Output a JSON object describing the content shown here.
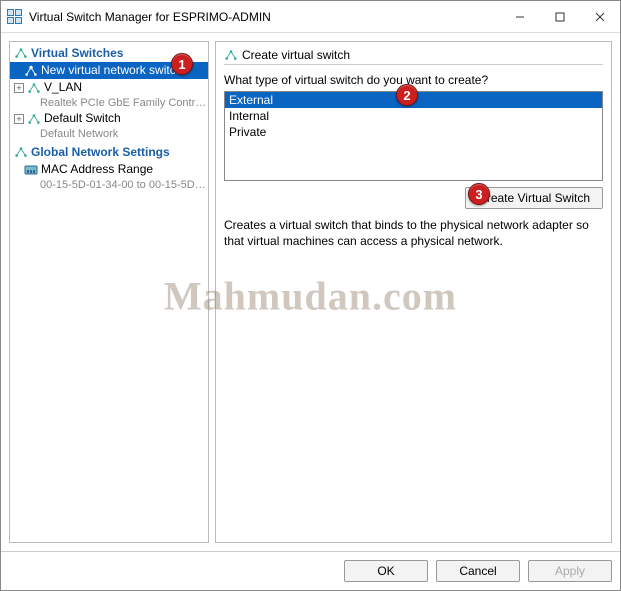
{
  "window": {
    "title": "Virtual Switch Manager for ESPRIMO-ADMIN"
  },
  "tree": {
    "virtual_switches_header": "Virtual Switches",
    "new_switch": "New virtual network switch",
    "vlan": {
      "name": "V_LAN",
      "desc": "Realtek PCIe GbE Family Controller"
    },
    "default_switch": {
      "name": "Default Switch",
      "desc": "Default Network"
    },
    "global_header": "Global Network Settings",
    "mac": {
      "name": "MAC Address Range",
      "desc": "00-15-5D-01-34-00 to 00-15-5D-0..."
    }
  },
  "right": {
    "heading": "Create virtual switch",
    "prompt": "What type of virtual switch do you want to create?",
    "options": {
      "external": "External",
      "internal": "Internal",
      "private": "Private"
    },
    "create_btn": "Create Virtual Switch",
    "description": "Creates a virtual switch that binds to the physical network adapter so that virtual machines can access a physical network."
  },
  "footer": {
    "ok": "OK",
    "cancel": "Cancel",
    "apply": "Apply"
  },
  "badges": {
    "b1": "1",
    "b2": "2",
    "b3": "3"
  },
  "watermark": "Mahmudan.com"
}
